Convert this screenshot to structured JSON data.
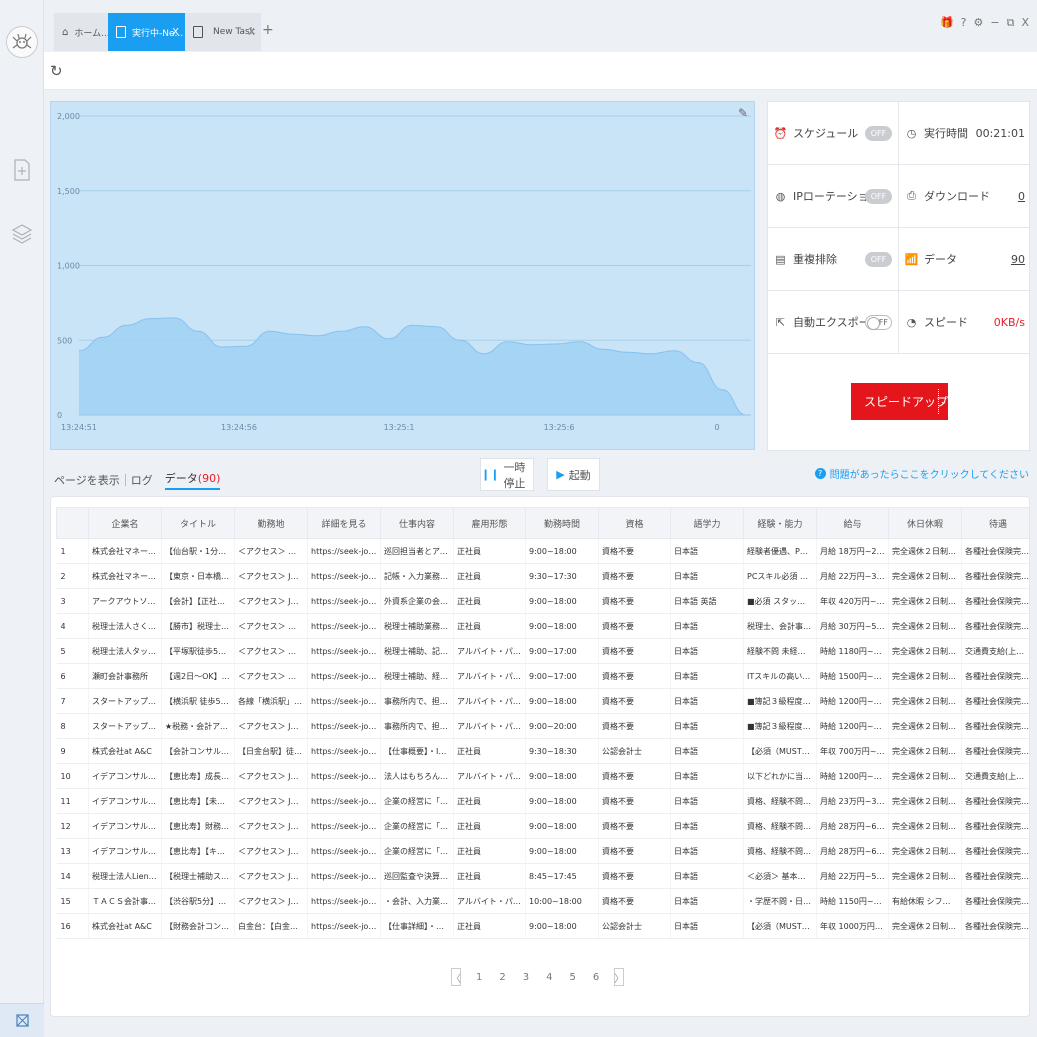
{
  "tabs": [
    {
      "label": "ホーム...",
      "icon": "home-icon"
    },
    {
      "label": "実行中-Ne...",
      "close": "X",
      "icon": "doc-icon"
    },
    {
      "label": "New Task",
      "close": "X",
      "icon": "doc-icon"
    }
  ],
  "tab_add": "+",
  "window_controls": [
    "🎁",
    "?",
    "⚙",
    "−",
    "⧉",
    "X"
  ],
  "colors": {
    "accent": "#1a9ef2",
    "red": "#e5161b",
    "chart_fill": "#9fd1f5"
  },
  "chart_data": {
    "type": "area",
    "x_ticks": [
      "13:24:51",
      "13:24:56",
      "13:25:1",
      "13:25:6",
      "0"
    ],
    "y_ticks": [
      "0",
      "500",
      "1,000",
      "1,500",
      "2,000"
    ],
    "ylim": [
      0,
      2000
    ],
    "series": [
      {
        "values": [
          430,
          520,
          600,
          645,
          650,
          560,
          455,
          460,
          560,
          540,
          530,
          560,
          590,
          510,
          600,
          590,
          500,
          410,
          490,
          470,
          475,
          490,
          440,
          420,
          410,
          430,
          350,
          170,
          0
        ]
      }
    ],
    "grid": true
  },
  "stats": {
    "schedule": {
      "label": "スケジュール",
      "toggle": "OFF"
    },
    "runtime": {
      "label": "実行時間",
      "value": "00:21:01"
    },
    "ip_rotation": {
      "label": "IPローテーション",
      "toggle": "OFF"
    },
    "download": {
      "label": "ダウンロード",
      "value": "0"
    },
    "dedupe": {
      "label": "重複排除",
      "toggle": "OFF"
    },
    "data": {
      "label": "データ",
      "value": "90"
    },
    "auto_export": {
      "label": "自動エクスポート",
      "toggle": "OFF"
    },
    "speed": {
      "label": "スピード",
      "value": "0KB/s"
    },
    "speedup_button": "スピードアップ"
  },
  "panel_tabs": {
    "show_page": "ページを表示",
    "log": "ログ",
    "data": "データ",
    "data_count": "(90)"
  },
  "buttons": {
    "pause": "一時停止",
    "start": "起動"
  },
  "help_text": "問題があったらここをクリックしてください",
  "table": {
    "headers": [
      "",
      "企業名",
      "タイトル",
      "勤務地",
      "詳細を見る",
      "仕事内容",
      "雇用形態",
      "勤務時間",
      "資格",
      "語学力",
      "経験・能力",
      "給与",
      "休日休暇",
      "待遇"
    ],
    "rows": [
      [
        "1",
        "株式会社マネージポ...",
        "【仙台駅・1分】【正...",
        "＜アクセス＞ 仙台駅...",
        "https://seek-job.jp/det...",
        "巡回担当者とアシス...",
        "正社員",
        "9:00~18:00",
        "資格不要",
        "日本語",
        "経験者優遇、PCスキ...",
        "月給 18万円~25万円",
        "完全週休２日制度(土...",
        "各種社会保険完備 交..."
      ],
      [
        "2",
        "株式会社マネージポ...",
        "【東京・日本橋】税...",
        "＜アクセス＞ JR総武...",
        "https://seek-job.jp/det...",
        "記帳・入力業務、税...",
        "正社員",
        "9:30~17:30",
        "資格不要",
        "日本語",
        "PCスキル必須 事務...",
        "月給 22万円~35万円",
        "完全週休２日制度(土...",
        "各種社会保険完備 交..."
      ],
      [
        "3",
        "アークアウトソーシ...",
        "【会計】【正社員】...",
        "＜アクセス＞ JR山手...",
        "https://seek-job.jp/det...",
        "外資系企業の会計・...",
        "正社員",
        "9:00~18:00",
        "資格不要",
        "日本語 英語",
        "■必須 スタッフ：実...",
        "年収 420万円~700万円",
        "完全週休２日制度(土...",
        "各種社会保険完備 交..."
      ],
      [
        "4",
        "税理士法人さくらゲ...",
        "【勝市】税理士補助...",
        "＜アクセス＞ 京浜東...",
        "https://seek-job.jp/det...",
        "税理士補助業務・会...",
        "正社員",
        "9:00~18:00",
        "資格不要",
        "日本語",
        "税理士、会計事務所...",
        "月給 30万円~50万円",
        "完全週休２日制度(土...",
        "各種社会保険完備 交..."
      ],
      [
        "5",
        "税理士法人タックス...",
        "【平塚駅徒歩5分】バ...",
        "＜アクセス＞ ＪＲ東...",
        "https://seek-job.jp/det...",
        "税理士補助、記帳・...",
        "アルバイト・パート",
        "9:00~17:00",
        "資格不要",
        "日本語",
        "経験不問 未経験可、...",
        "時給 1180円~1500円",
        "完全週休２日制度(土...",
        "交通費支給(上限有り)..."
      ],
      [
        "6",
        "瀬町会計事務所",
        "【週2日～OK】経理...",
        "＜アクセス＞ 有楽町...",
        "https://seek-job.jp/det...",
        "税理士補助、経理、...",
        "アルバイト・パート",
        "9:00~17:00",
        "資格不要",
        "日本語",
        "ITスキルの高い方、...",
        "時給 1500円~2200円",
        "完全週休２日制度(土...",
        "各種社会保険完備 通..."
      ],
      [
        "7",
        "スタートアップ税理...",
        "【横浜駅 徒歩5分】...",
        "各線「横浜駅」から...",
        "https://seek-job.jp/det...",
        "事務所内で、担当ク...",
        "アルバイト・パート",
        "9:00~18:00",
        "資格不要",
        "日本語",
        "■簿記３級程度の知...",
        "時給 1200円~1500円",
        "完全週休２日制度(土...",
        "各種社会保険完備 交..."
      ],
      [
        "8",
        "スタートアップ税理...",
        "★税務・会計アシス...",
        "＜アクセス＞ JR各線...",
        "https://seek-job.jp/det...",
        "事務所内で、担当ク...",
        "アルバイト・パート",
        "9:00~20:00",
        "資格不要",
        "日本語",
        "■簿記３級程度の知...",
        "時給 1200円~1500円",
        "完全週休２日制度(土...",
        "各種社会保険完備 交..."
      ],
      [
        "9",
        "株式会社at A&C",
        "【会計コンサルタン...",
        "【日金台駅】徒歩5分...",
        "https://seek-job.jp/det...",
        "【仕事概要】・IPO/...",
        "正社員",
        "9:30~18:30",
        "公認会計士",
        "日本語",
        "【必須（MUST）】...",
        "年収 700万円~1000...",
        "完全週休２日制度(土...",
        "各種社会保険完備 交..."
      ],
      [
        "10",
        "イデアコンサルティ...",
        "【恵比寿】成長を実...",
        "＜アクセス＞ JR線「...",
        "https://seek-job.jp/det...",
        "法人はもちろん、資...",
        "アルバイト・パート",
        "9:00~18:00",
        "資格不要",
        "日本語",
        "以下どれかに当ては...",
        "時給 1200円~1200円",
        "完全週休２日制度(土...",
        "交通費支給(上限有り)..."
      ],
      [
        "11",
        "イデアコンサルティ...",
        "【恵比寿】【未経験...",
        "＜アクセス＞ JR線「...",
        "https://seek-job.jp/det...",
        "企業の経営に「お金...",
        "正社員",
        "9:00~18:00",
        "資格不要",
        "日本語",
        "資格、経験不問（税...",
        "月給 23万円~35万円",
        "完全週休２日制度(土...",
        "各種社会保険完備 交..."
      ],
      [
        "12",
        "イデアコンサルティ...",
        "【恵比寿】財務コン...",
        "＜アクセス＞ JR線「...",
        "https://seek-job.jp/det...",
        "企業の経営に「お金...",
        "正社員",
        "9:00~18:00",
        "資格不要",
        "日本語",
        "資格、経験不問（税...",
        "月給 28万円~61万円",
        "完全週休２日制度(土...",
        "各種社会保険完備 交..."
      ],
      [
        "13",
        "イデアコンサルティ...",
        "【恵比寿】【キャリ...",
        "＜アクセス＞ JR線「...",
        "https://seek-job.jp/det...",
        "企業の経営に「お金...",
        "正社員",
        "9:00~18:00",
        "資格不要",
        "日本語",
        "資格、経験不問（税...",
        "月給 28万円~61万円",
        "完全週休２日制度(土...",
        "各種社会保険完備 交..."
      ],
      [
        "14",
        "税理士法人LienFort",
        "【税理士補助スタッ...",
        "＜アクセス＞ JR山手...",
        "https://seek-job.jp/det...",
        "巡回監査や決算・申...",
        "正社員",
        "8:45~17:45",
        "資格不要",
        "日本語",
        "＜必須＞ 基本的なP...",
        "月給 22万円~50万円",
        "完全週休２日制度(土...",
        "各種社会保険完備 交..."
      ],
      [
        "15",
        "ＴＡＣＳ会計事務所",
        "【渋谷駅5分】会計ア...",
        "＜アクセス＞ JR「渋...",
        "https://seek-job.jp/det...",
        "・会計、入力業務、...",
        "アルバイト・パート",
        "10:00~18:00",
        "資格不要",
        "日本語",
        "・学歴不問・日商簿...",
        "時給 1150円~1700円",
        "有給休暇 シフト制",
        "各種社会保険完備 通..."
      ],
      [
        "16",
        "株式会社at A&C",
        "【財務会計コンサル...",
        "白金台：【白金台駅...",
        "https://seek-job.jp/det...",
        "【仕事詳細】・財務...",
        "正社員",
        "9:00~18:00",
        "公認会計士",
        "日本語",
        "【必須（MUST）】...",
        "年収 1000万円~125...",
        "完全週休２日制度(土...",
        "各種社会保険完備 交..."
      ]
    ]
  },
  "pager": {
    "prev": "〈",
    "next": "〉",
    "pages": [
      "1",
      "2",
      "3",
      "4",
      "5",
      "6"
    ],
    "current": "1"
  }
}
